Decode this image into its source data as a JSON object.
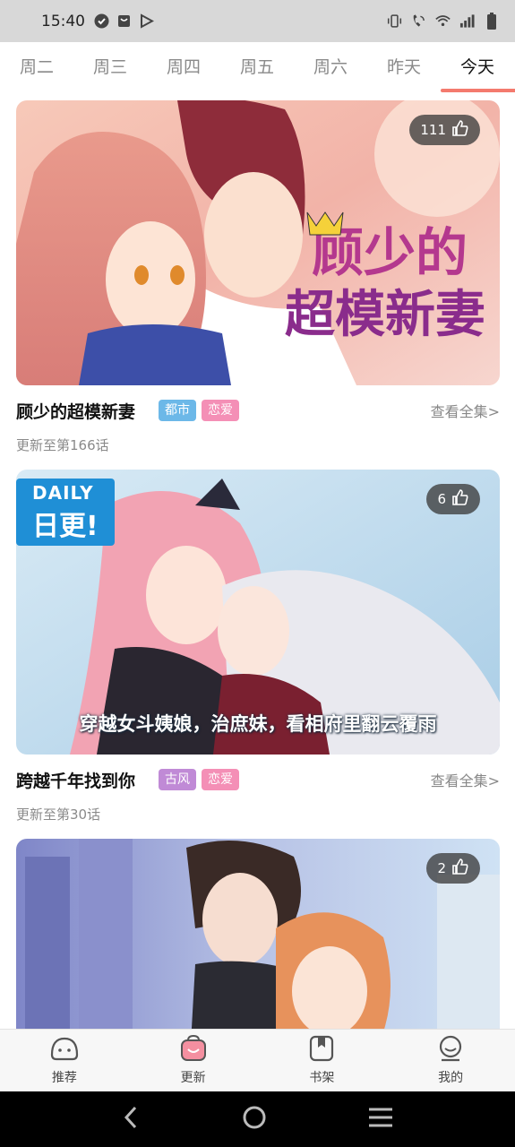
{
  "status": {
    "time": "15:40"
  },
  "tabs": [
    {
      "label": "周二"
    },
    {
      "label": "周三"
    },
    {
      "label": "周四"
    },
    {
      "label": "周五"
    },
    {
      "label": "周六"
    },
    {
      "label": "昨天"
    },
    {
      "label": "今天",
      "active": true
    }
  ],
  "cards": [
    {
      "likes": "111",
      "title": "顾少的超模新妻",
      "tags": [
        {
          "label": "都市",
          "color": "#6cb8e8"
        },
        {
          "label": "恋爱",
          "color": "#f48fb6"
        }
      ],
      "view_all": "查看全集>",
      "update": "更新至第166话",
      "cover_text": "顾少的超模新妻"
    },
    {
      "likes": "6",
      "title": "跨越千年找到你",
      "tags": [
        {
          "label": "古风",
          "color": "#c08ad6"
        },
        {
          "label": "恋爱",
          "color": "#f48fb6"
        }
      ],
      "view_all": "查看全集>",
      "update": "更新至第30话",
      "badge_en": "DAILY",
      "badge_cn": "日更!",
      "cover_caption": "穿越女斗姨娘，治庶妹，看相府里翻云覆雨"
    },
    {
      "likes": "2"
    }
  ],
  "bottom_nav": [
    {
      "label": "推荐",
      "icon": "recommend-icon"
    },
    {
      "label": "更新",
      "icon": "update-icon",
      "active": true
    },
    {
      "label": "书架",
      "icon": "bookshelf-icon"
    },
    {
      "label": "我的",
      "icon": "profile-icon"
    }
  ],
  "colors": {
    "accent": "#f47a6e",
    "tab_inactive": "#8a8a8a"
  }
}
